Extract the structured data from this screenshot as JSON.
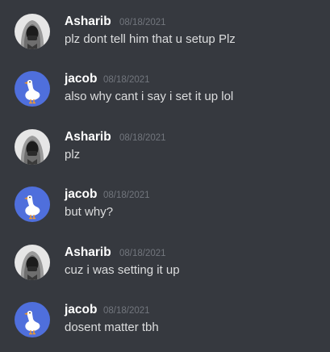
{
  "colors": {
    "background": "#36393f",
    "username": "#ffffff",
    "timestamp": "#72767d",
    "message_text": "#dcddde",
    "goose_avatar_bg": "#4f6fdc"
  },
  "messages": [
    {
      "author": "Asharib",
      "timestamp": "08/18/2021",
      "text": "plz dont tell him that u setup Plz",
      "avatar": "hooded-figure-icon"
    },
    {
      "author": "jacob",
      "timestamp": "08/18/2021",
      "text": "also why cant i say i set it up lol",
      "avatar": "goose-icon"
    },
    {
      "author": "Asharib",
      "timestamp": "08/18/2021",
      "text": "plz",
      "avatar": "hooded-figure-icon"
    },
    {
      "author": "jacob",
      "timestamp": "08/18/2021",
      "text": "but why?",
      "avatar": "goose-icon"
    },
    {
      "author": "Asharib",
      "timestamp": "08/18/2021",
      "text": "cuz i was setting it up",
      "avatar": "hooded-figure-icon"
    },
    {
      "author": "jacob",
      "timestamp": "08/18/2021",
      "text": "dosent matter tbh",
      "avatar": "goose-icon"
    }
  ]
}
